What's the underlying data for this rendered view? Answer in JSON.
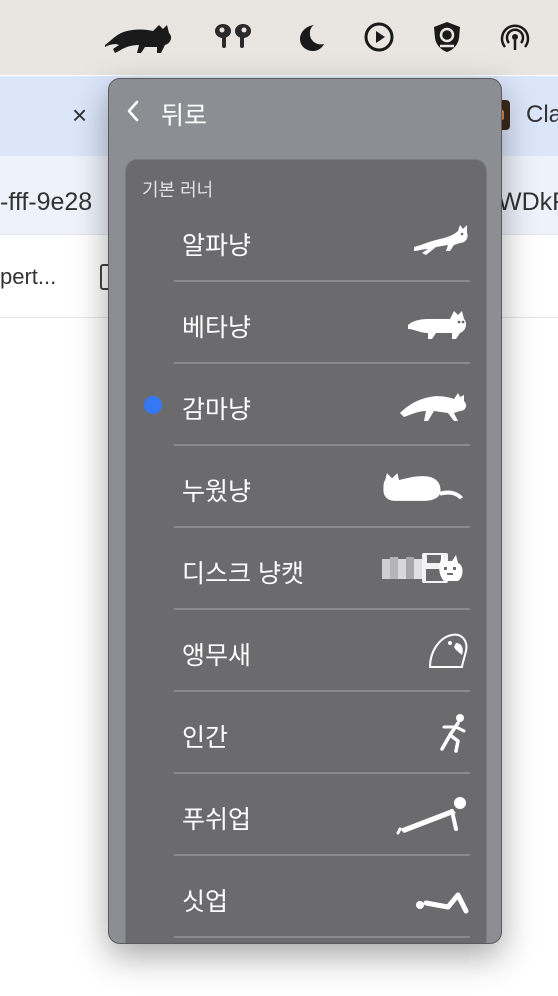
{
  "menubar": {
    "icons": [
      "runcat-cat-icon",
      "airpods-icon",
      "focus-moon-icon",
      "play-circle-icon",
      "security-shield-icon",
      "airdrop-icon"
    ]
  },
  "background": {
    "tab_close": "×",
    "tab_title": "Cla",
    "url_left": "-fff-9e28",
    "url_right": "WDkF",
    "bookmark_left": "pert..."
  },
  "menu": {
    "back_label": "뒤로",
    "section_label": "기본 러너",
    "selected_color": "#3478f6",
    "items": [
      {
        "label": "알파냥",
        "icon": "alpha-cat-icon",
        "selected": false
      },
      {
        "label": "베타냥",
        "icon": "beta-cat-icon",
        "selected": false
      },
      {
        "label": "감마냥",
        "icon": "gamma-cat-icon",
        "selected": true
      },
      {
        "label": "누웠냥",
        "icon": "lying-cat-icon",
        "selected": false
      },
      {
        "label": "디스크 냥캣",
        "icon": "disk-nyancat-icon",
        "selected": false
      },
      {
        "label": "앵무새",
        "icon": "parrot-icon",
        "selected": false
      },
      {
        "label": "인간",
        "icon": "running-human-icon",
        "selected": false
      },
      {
        "label": "푸쉬업",
        "icon": "pushup-icon",
        "selected": false
      },
      {
        "label": "싯업",
        "icon": "situp-icon",
        "selected": false
      }
    ]
  }
}
